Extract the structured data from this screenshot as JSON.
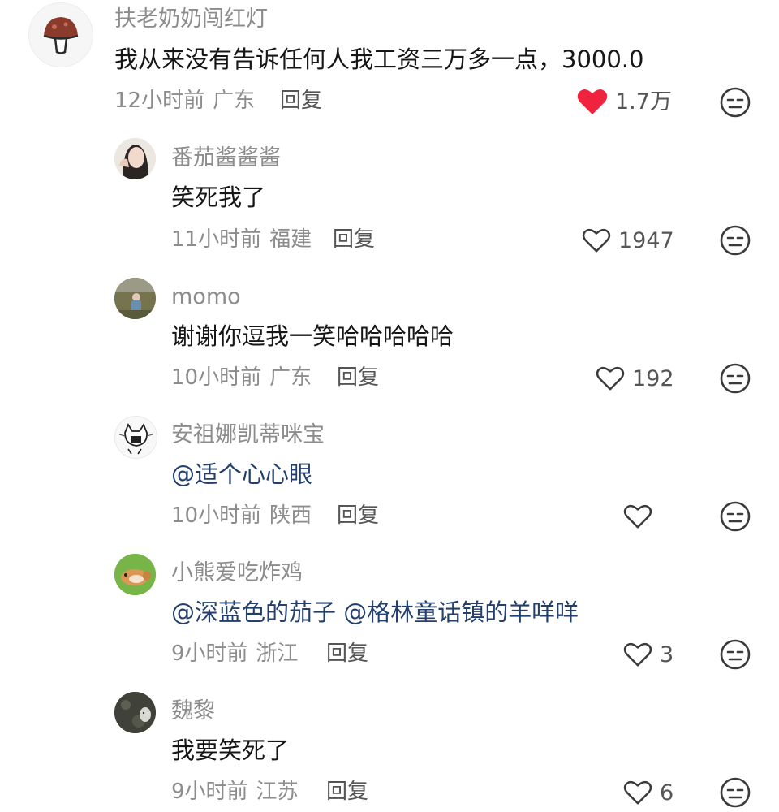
{
  "comments": [
    {
      "username": "扶老奶奶闯红灯",
      "text": "我从来没有告诉任何人我工资三万多一点，3000.0",
      "time": "12小时前",
      "location": "广东",
      "reply_label": "回复",
      "likes": "1.7万",
      "liked": true,
      "avatar": "mushroom-avatar"
    },
    {
      "username": "番茄酱酱酱",
      "text": "笑死我了",
      "time": "11小时前",
      "location": "福建",
      "reply_label": "回复",
      "likes": "1947",
      "liked": false,
      "avatar": "girl-photo-avatar"
    },
    {
      "username": "momo",
      "text": "谢谢你逗我一笑哈哈哈哈哈",
      "time": "10小时前",
      "location": "广东",
      "reply_label": "回复",
      "likes": "192",
      "liked": false,
      "avatar": "outdoor-photo-avatar"
    },
    {
      "username": "安祖娜凯蒂咪宝",
      "text": "@适个心心眼",
      "time": "10小时前",
      "location": "陕西",
      "reply_label": "回复",
      "likes": "",
      "liked": false,
      "avatar": "cat-sketch-avatar"
    },
    {
      "username": "小熊爱吃炸鸡",
      "text": "@深蓝色的茄子 @格林童话镇的羊咩咩",
      "time": "9小时前",
      "location": "浙江",
      "reply_label": "回复",
      "likes": "3",
      "liked": false,
      "avatar": "hamster-photo-avatar"
    },
    {
      "username": "魏黎",
      "text": "我要笑死了",
      "time": "9小时前",
      "location": "江苏",
      "reply_label": "回复",
      "likes": "6",
      "liked": false,
      "avatar": "dark-photo-avatar"
    }
  ],
  "icons": {
    "like": "heart-icon",
    "dislike": "dislike-face-icon"
  },
  "colors": {
    "liked_heart": "#f0233e",
    "mention": "#233f6e",
    "meta_text": "#8c8c8c"
  }
}
